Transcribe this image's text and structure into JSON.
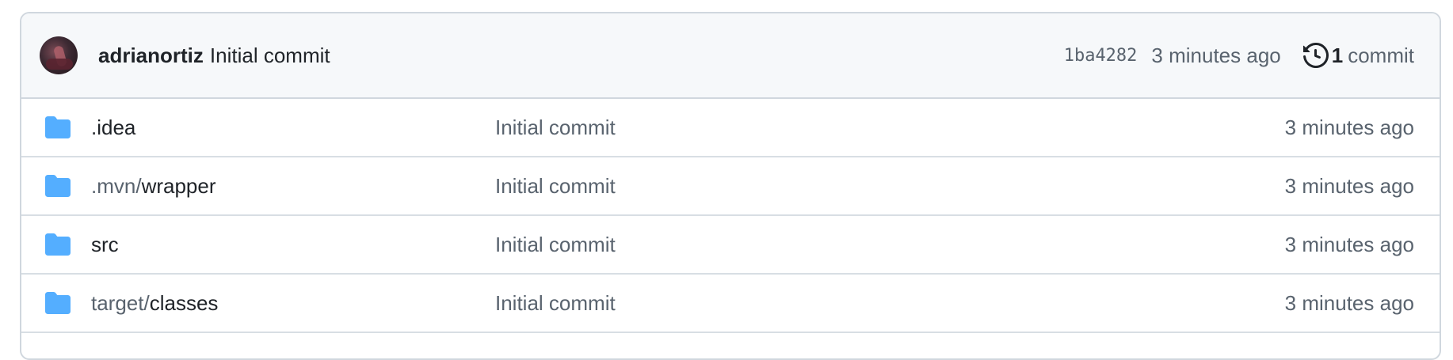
{
  "header": {
    "author": "adrianortiz",
    "message": "Initial commit",
    "sha": "1ba4282",
    "time": "3 minutes ago",
    "history": {
      "count": "1",
      "label": "commit",
      "icon": "history-icon"
    }
  },
  "rows": [
    {
      "name_prefix": "",
      "name": ".idea",
      "message": "Initial commit",
      "time": "3 minutes ago",
      "icon": "folder-icon"
    },
    {
      "name_prefix": ".mvn/",
      "name": "wrapper",
      "message": "Initial commit",
      "time": "3 minutes ago",
      "icon": "folder-icon"
    },
    {
      "name_prefix": "",
      "name": "src",
      "message": "Initial commit",
      "time": "3 minutes ago",
      "icon": "folder-icon"
    },
    {
      "name_prefix": "target/",
      "name": "classes",
      "message": "Initial commit",
      "time": "3 minutes ago",
      "icon": "folder-icon"
    }
  ],
  "colors": {
    "folder": "#54aeff",
    "muted": "#59636e",
    "border": "#d0d7de",
    "header_bg": "#f6f8fa"
  }
}
